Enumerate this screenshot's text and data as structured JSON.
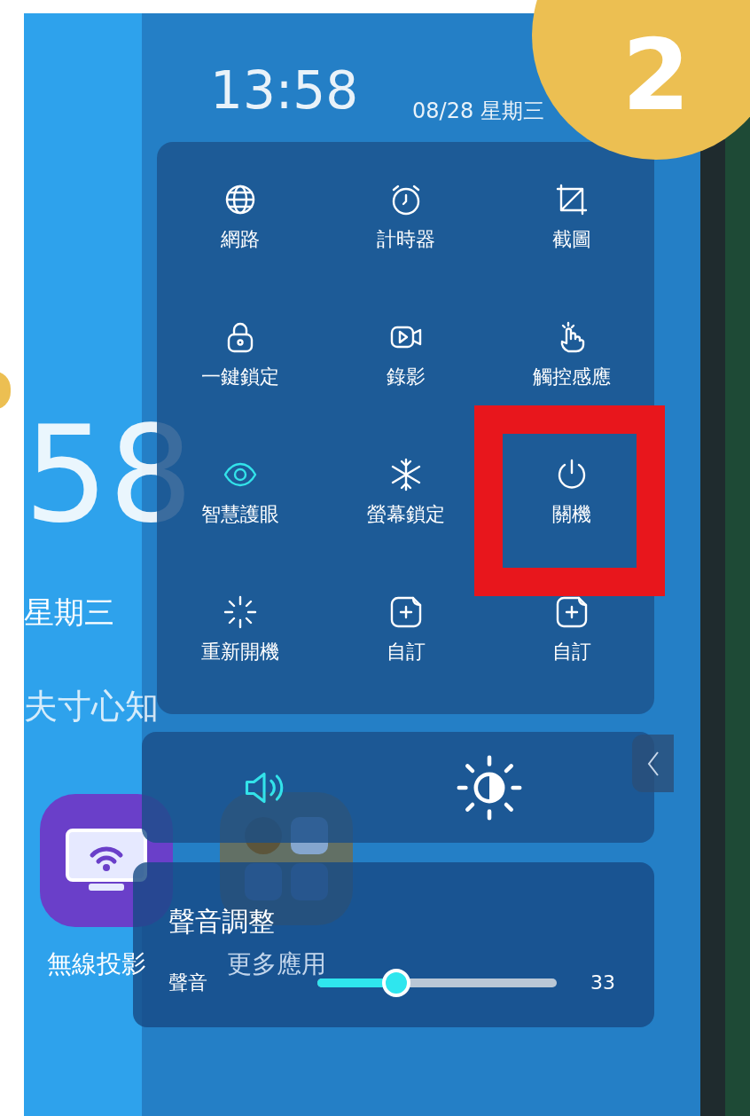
{
  "status": {
    "time": "13:58",
    "date": "08/28 星期三"
  },
  "tiles": [
    {
      "label": "網路",
      "kind": "globe",
      "active": false,
      "highlighted": false
    },
    {
      "label": "計時器",
      "kind": "alarm",
      "active": false,
      "highlighted": false
    },
    {
      "label": "截圖",
      "kind": "crop",
      "active": false,
      "highlighted": false
    },
    {
      "label": "一鍵鎖定",
      "kind": "lock",
      "active": false,
      "highlighted": false
    },
    {
      "label": "錄影",
      "kind": "video",
      "active": false,
      "highlighted": false
    },
    {
      "label": "觸控感應",
      "kind": "touch",
      "active": false,
      "highlighted": false
    },
    {
      "label": "智慧護眼",
      "kind": "eye",
      "active": true,
      "highlighted": false
    },
    {
      "label": "螢幕鎖定",
      "kind": "snowflake",
      "active": false,
      "highlighted": false
    },
    {
      "label": "關機",
      "kind": "power",
      "active": false,
      "highlighted": true
    },
    {
      "label": "重新開機",
      "kind": "restart",
      "active": false,
      "highlighted": false
    },
    {
      "label": "自訂",
      "kind": "add",
      "active": false,
      "highlighted": false
    },
    {
      "label": "自訂",
      "kind": "add",
      "active": false,
      "highlighted": false
    }
  ],
  "quick_toggles": [
    {
      "kind": "speaker",
      "active": true
    },
    {
      "kind": "brightness",
      "active": false
    }
  ],
  "volume_panel": {
    "title": "聲音調整",
    "label": "聲音",
    "level": 0.33,
    "reading": "33"
  },
  "home": {
    "clock": "58",
    "weekday": "星期三",
    "quote": "夫寸心知",
    "apps": [
      {
        "label": "無線投影",
        "kind": "cast"
      },
      {
        "label": "更多應用",
        "kind": "grid"
      }
    ]
  },
  "step_badge": "2"
}
